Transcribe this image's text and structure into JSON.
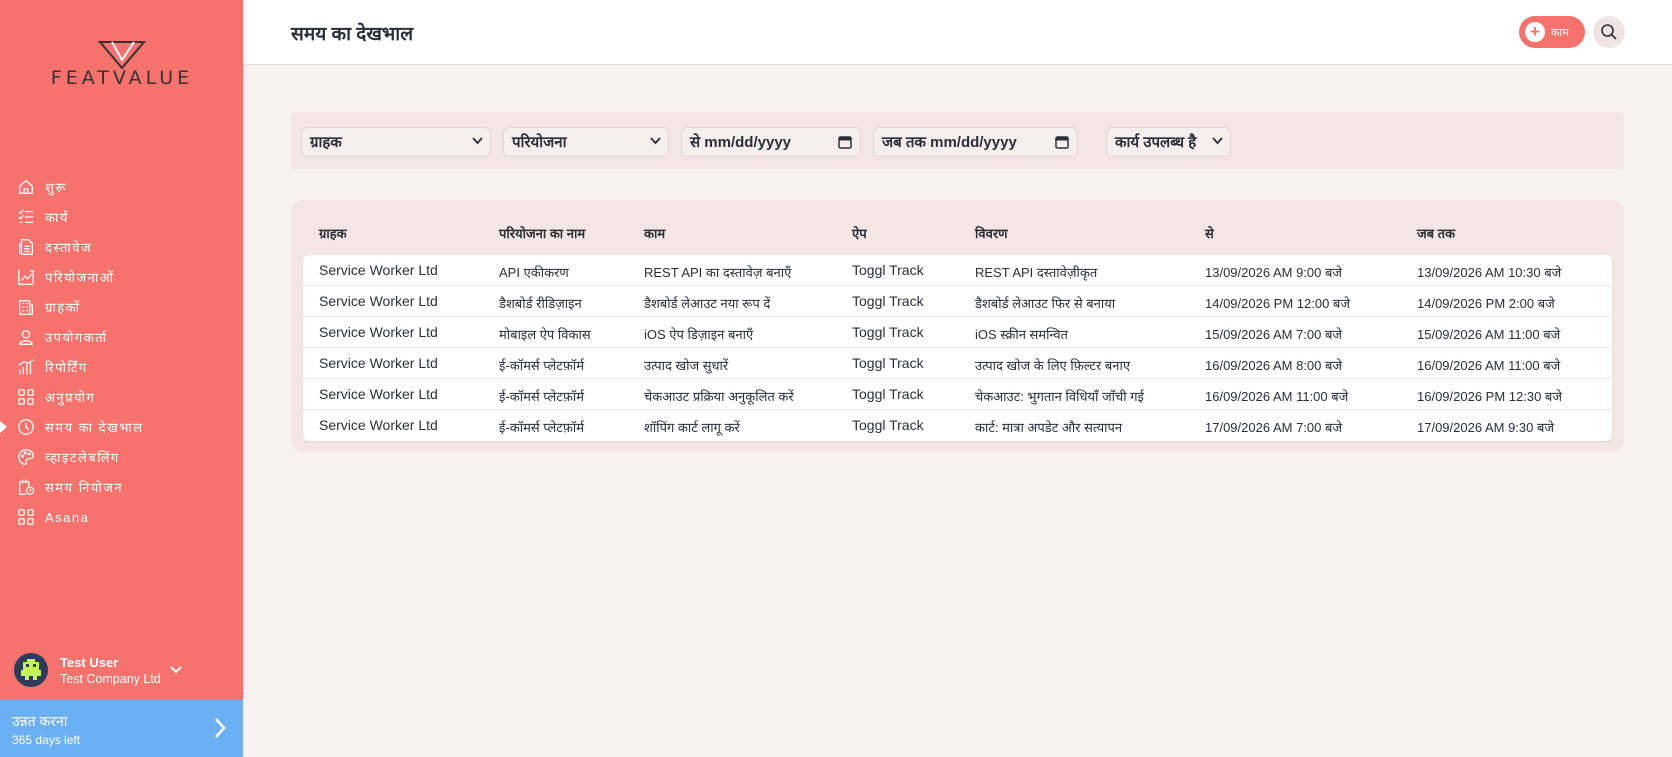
{
  "sidebar": {
    "logo_text": "FEATVALUE",
    "items": [
      {
        "label": "शुरू",
        "icon": "home-icon"
      },
      {
        "label": "कार्य",
        "icon": "checklist-icon"
      },
      {
        "label": "दस्तावेज",
        "icon": "document-icon"
      },
      {
        "label": "परियोजनाओं",
        "icon": "chart-icon"
      },
      {
        "label": "ग्राहकों",
        "icon": "building-icon"
      },
      {
        "label": "उपयोगकर्ता",
        "icon": "user-icon"
      },
      {
        "label": "रिपोर्टिंग",
        "icon": "bar-chart-icon"
      },
      {
        "label": "अनुप्रयोग",
        "icon": "apps-icon"
      },
      {
        "label": "समय का देखभाल",
        "icon": "clock-icon",
        "active": true
      },
      {
        "label": "व्हाइटलेबलिंग",
        "icon": "palette-icon"
      },
      {
        "label": "समय नियोजन",
        "icon": "calendar-clock-icon"
      },
      {
        "label": "Asana",
        "icon": "apps-icon"
      }
    ],
    "user": {
      "name": "Test User",
      "company": "Test Company Ltd"
    },
    "upgrade": {
      "title": "उन्नत करना",
      "subtitle": "365 days left"
    }
  },
  "header": {
    "title": "समय का देखभाल",
    "add_label": "काम"
  },
  "filters": {
    "client": "ग्राहक",
    "project": "परियोजना",
    "from": "से mm/dd/yyyy",
    "to": "जब तक mm/dd/yyyy",
    "task": "कार्य उपलब्ध है"
  },
  "table": {
    "columns": [
      "ग्राहक",
      "परियोजना का नाम",
      "काम",
      "ऐप",
      "विवरण",
      "से",
      "जब तक"
    ],
    "rows": [
      [
        "Service Worker Ltd",
        "API एकीकरण",
        "REST API का दस्तावेज़ बनाएँ",
        "Toggl Track",
        "REST API दस्तावेज़ीकृत",
        "13/09/2026 AM 9:00 बजे",
        "13/09/2026 AM 10:30 बजे"
      ],
      [
        "Service Worker Ltd",
        "डैशबोर्ड रीडिज़ाइन",
        "डैशबोर्ड लेआउट नया रूप दें",
        "Toggl Track",
        "डैशबोर्ड लेआउट फिर से बनाया",
        "14/09/2026 PM 12:00 बजे",
        "14/09/2026 PM 2:00 बजे"
      ],
      [
        "Service Worker Ltd",
        "मोबाइल ऐप विकास",
        "iOS ऐप डिज़ाइन बनाएँ",
        "Toggl Track",
        "iOS स्क्रीन समन्वित",
        "15/09/2026 AM 7:00 बजे",
        "15/09/2026 AM 11:00 बजे"
      ],
      [
        "Service Worker Ltd",
        "ई-कॉमर्स प्लेटफ़ॉर्म",
        "उत्पाद खोज सुधारें",
        "Toggl Track",
        "उत्पाद खोज के लिए फ़िल्टर बनाए",
        "16/09/2026 AM 8:00 बजे",
        "16/09/2026 AM 11:00 बजे"
      ],
      [
        "Service Worker Ltd",
        "ई-कॉमर्स प्लेटफ़ॉर्म",
        "चेकआउट प्रक्रिया अनुकूलित करें",
        "Toggl Track",
        "चेकआउट: भुगतान विधियाँ जाँची गई",
        "16/09/2026 AM 11:00 बजे",
        "16/09/2026 PM 12:30 बजे"
      ],
      [
        "Service Worker Ltd",
        "ई-कॉमर्स प्लेटफ़ॉर्म",
        "शॉपिंग कार्ट लागू करें",
        "Toggl Track",
        "कार्ट: मात्रा अपडेट और सत्यापन",
        "17/09/2026 AM 7:00 बजे",
        "17/09/2026 AM 9:30 बजे"
      ]
    ]
  }
}
